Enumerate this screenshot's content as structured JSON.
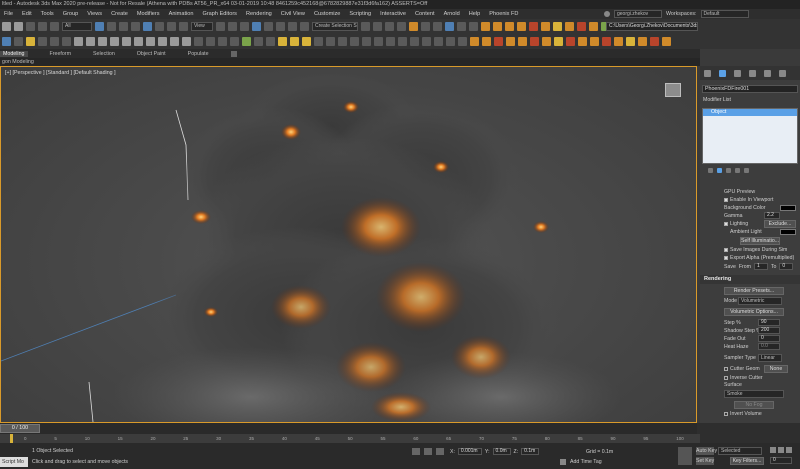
{
  "window": {
    "title": "ltled - Autodesk 3ds Max 2020 pre-release - Not for Resale (Athena with PDBs AT56_PR_x64 03-01-2019 10:48 8461259c452168@6782829887e31f3d6fa162) ASSERTS=Off"
  },
  "menu": {
    "items": [
      "File",
      "Edit",
      "Tools",
      "Group",
      "Views",
      "Create",
      "Modifiers",
      "Animation",
      "Graph Editors",
      "Rendering",
      "Civil View",
      "Customize",
      "Scripting",
      "Interactive",
      "Content",
      "Arnold",
      "Help",
      "Phoenix FD"
    ]
  },
  "topright": {
    "user": "georgi.zhekov",
    "workspaces_label": "Workspaces:",
    "workspace_value": "Default",
    "path": "C:\\Users\\Georgi.Zhekov\\Documents\\3ds Max 2020"
  },
  "toolbar": {
    "selection_filter": "All",
    "view_dropdown": "View",
    "create_selection_set": "Create Selection Se"
  },
  "ribbon": {
    "tabs": [
      "Modeling",
      "Freeform",
      "Selection",
      "Object Paint",
      "Populate"
    ],
    "sub": "gon Modeling"
  },
  "viewport": {
    "label": "[+] [Perspective ] [Standard ] [Default Shading ]"
  },
  "command_panel": {
    "object_name": "PhoenixFDFire001",
    "modifier_list": "Modifier List",
    "stack_item": "Object",
    "gpu_preview": {
      "title": "GPU Preview",
      "enable_in_viewport": "Enable In Viewport",
      "background_color": "Background Color",
      "gamma_label": "Gamma",
      "gamma_value": "2.2",
      "lighting": "Lighting",
      "exclude": "Exclude...",
      "ambient_light": "Ambient Light",
      "self_illumiation": "Self Illuminatio...",
      "save_images": "Save Images During Sim",
      "export_alpha": "Export Alpha (Premultiplied)",
      "save_label": "Save",
      "from_label": "From",
      "from_value": "1",
      "to_label": "To",
      "to_value": "0"
    },
    "rendering": {
      "title": "Rendering",
      "render_presets": "Render Presets...",
      "mode_label": "Mode",
      "mode_value": "Volumetric",
      "volumetric_options": "Volumetric Options...",
      "step_label": "Step %",
      "step_value": "90",
      "shadow_step_label": "Shadow Step %",
      "shadow_step_value": "200",
      "fade_out_label": "Fade Out",
      "fade_out_value": "0",
      "heat_haze_label": "Heat Haze",
      "heat_haze_value": "0.0",
      "sampler_type_label": "Sampler Type",
      "sampler_type_value": "Linear",
      "cutter_geom": "Cutter Geom",
      "cutter_value": "None",
      "inverse_cutter": "Inverse Cutter",
      "surface_label": "Surface",
      "surface_value": "Smoke",
      "no_fog": "No Fog",
      "invert_volume": "Invert Volume"
    }
  },
  "timeline": {
    "frame_display": "0 / 100",
    "ticks": [
      "0",
      "5",
      "10",
      "15",
      "20",
      "25",
      "30",
      "35",
      "40",
      "45",
      "50",
      "55",
      "60",
      "65",
      "70",
      "75",
      "80",
      "85",
      "90",
      "95",
      "100"
    ]
  },
  "status": {
    "maxscript": "Script Mo",
    "selected": "1 Object Selected",
    "hint": "Click and drag to select and move objects",
    "x_label": "X:",
    "x_value": "0.001m",
    "y_label": "Y:",
    "y_value": "0.0m",
    "z_label": "Z:",
    "z_value": "0.1m",
    "grid": "Grid = 0.1m",
    "add_time_tag": "Add Time Tag",
    "auto_key": "Auto Key",
    "set_key": "Set Key",
    "selected_dropdown": "Selected",
    "key_filters": "Key Filters...",
    "frame_field": "0"
  }
}
